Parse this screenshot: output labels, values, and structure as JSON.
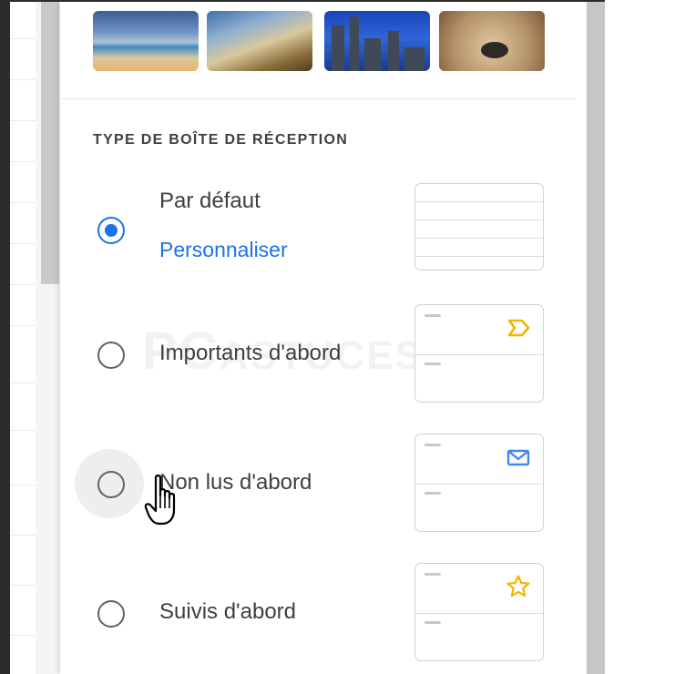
{
  "section": {
    "title": "TYPE DE BOÎTE DE RÉCEPTION"
  },
  "inbox_types": [
    {
      "label": "Par défaut",
      "link": "Personnaliser",
      "selected": true,
      "icon": null
    },
    {
      "label": "Importants d'abord",
      "selected": false,
      "icon": "important-marker-icon"
    },
    {
      "label": "Non lus d'abord",
      "selected": false,
      "icon": "envelope-icon"
    },
    {
      "label": "Suivis d'abord",
      "selected": false,
      "icon": "star-icon"
    }
  ],
  "watermark": {
    "text1": "PC",
    "text2": "ASTUCES"
  },
  "colors": {
    "accent": "#1a73e8",
    "text": "#3c4043",
    "important": "#f4b400",
    "envelope": "#4285f4",
    "star": "#f4b400"
  }
}
